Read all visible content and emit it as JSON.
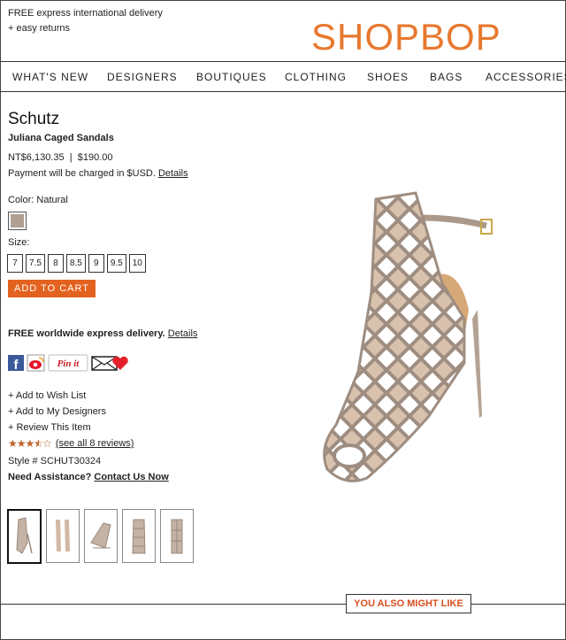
{
  "header": {
    "promo_line1": "FREE express international delivery",
    "promo_line2": "+ easy returns",
    "logo": "SHOPBOP",
    "logo_color": "#e8782f"
  },
  "nav": {
    "items": [
      "WHAT'S NEW",
      "DESIGNERS",
      "BOUTIQUES",
      "CLOTHING",
      "SHOES",
      "BAGS",
      "ACCESSORIES"
    ]
  },
  "product": {
    "brand": "Schutz",
    "name": "Juliana Caged Sandals",
    "price_local": "NT$6,130.35",
    "price_sep": "|",
    "price_usd": "$190.00",
    "usd_note": "Payment will be charged in $USD.",
    "details_link": "Details",
    "color_label": "Color: Natural",
    "swatch_color": "#b09f92",
    "size_label": "Size:",
    "sizes": [
      "7",
      "7.5",
      "8",
      "8.5",
      "9",
      "9.5",
      "10"
    ],
    "add_to_cart": "ADD TO CART",
    "add_to_cart_color": "#e3621f",
    "free_delivery": "FREE worldwide express delivery.",
    "free_delivery_link": "Details",
    "pinit": "Pin it",
    "wish_list": "+ Add to Wish List",
    "my_designers": "+ Add to My Designers",
    "review": "+ Review This Item",
    "rating": 3.5,
    "reviews_link": "(see all 8 reviews)",
    "style": "Style # SCHUT30324",
    "assist_label": "Need Assistance?",
    "contact_link": "Contact Us Now"
  },
  "footer": {
    "you_also_might_like": "YOU ALSO MIGHT LIKE",
    "accent": "#d94e1f"
  }
}
